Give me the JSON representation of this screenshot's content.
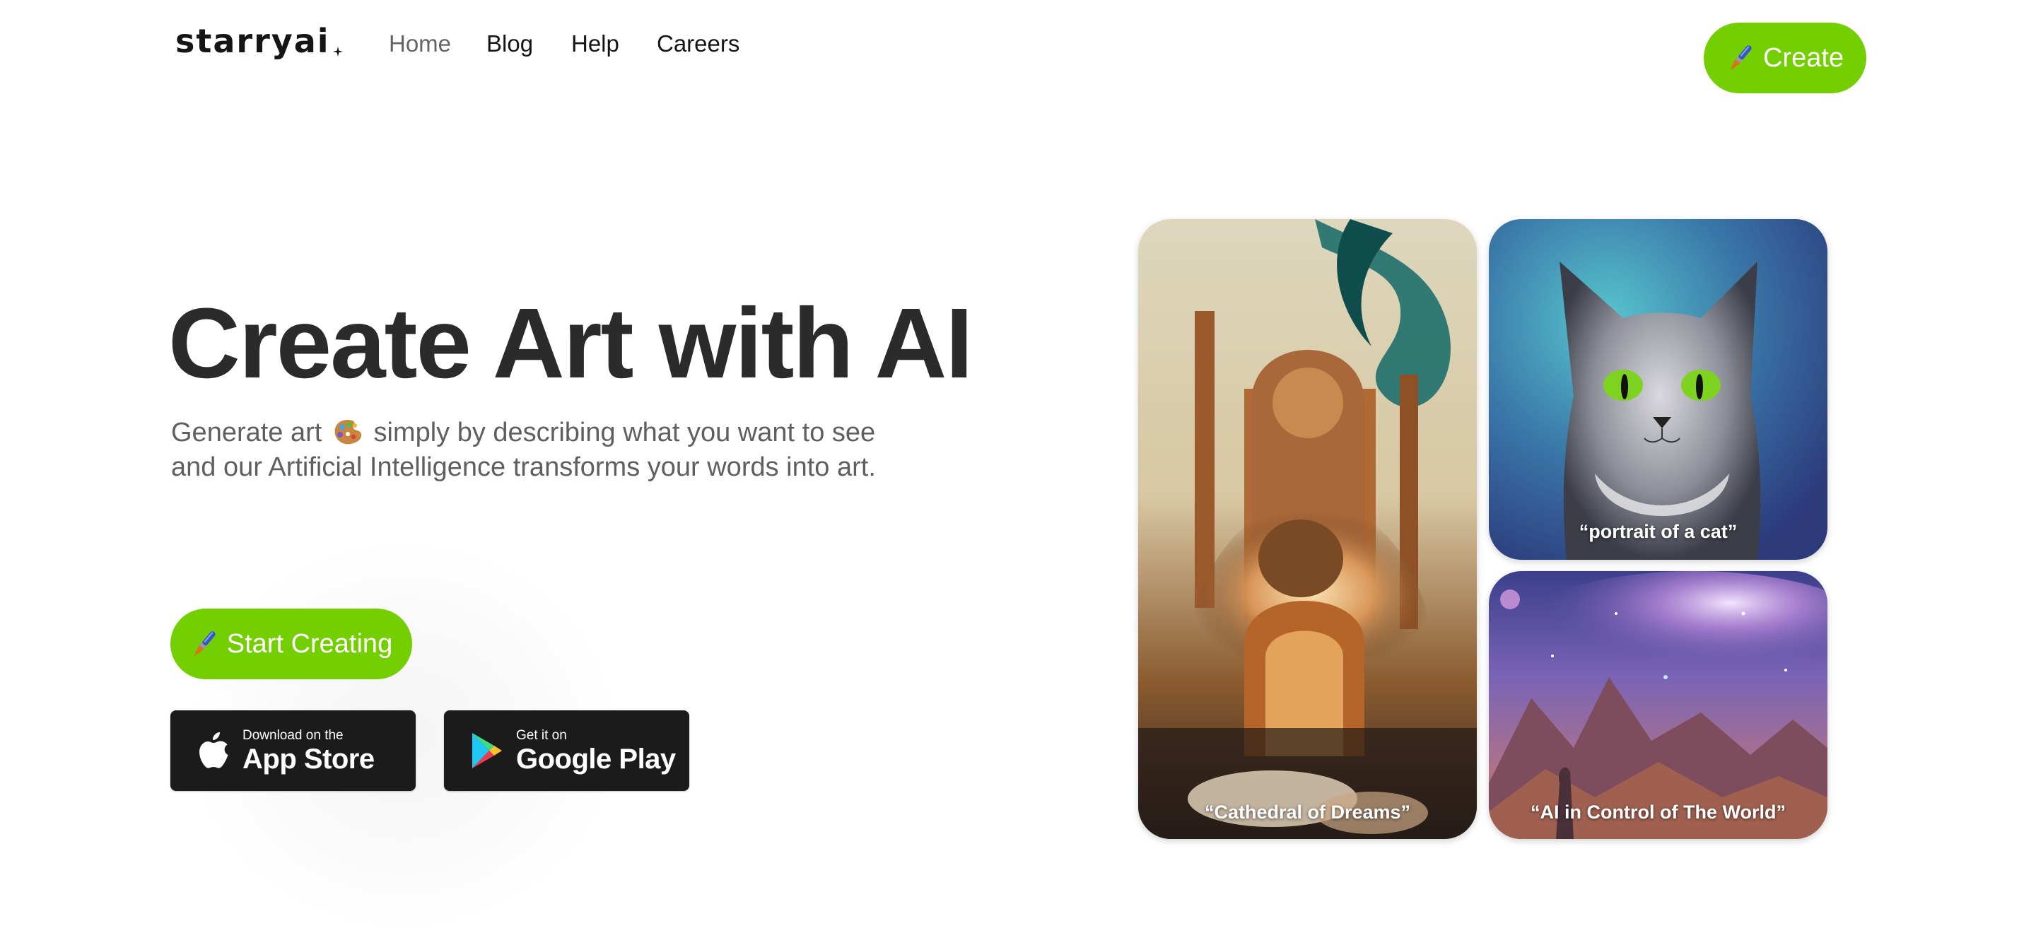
{
  "header": {
    "logo_text": "starryai",
    "logo_icon": "sparkle-icon",
    "nav": [
      {
        "label": "Home",
        "active": true
      },
      {
        "label": "Blog",
        "active": false
      },
      {
        "label": "Help",
        "active": false
      },
      {
        "label": "Careers",
        "active": false
      }
    ],
    "create_button": {
      "label": "Create",
      "icon": "paintbrush-icon"
    }
  },
  "hero": {
    "title": "Create Art with AI",
    "subtitle_line1_before": "Generate art",
    "subtitle_icon": "artist-palette-icon",
    "subtitle_line1_after": "simply by describing what you want to see",
    "subtitle_line2": "and our Artificial Intelligence transforms your words into art.",
    "start_button": {
      "label": "Start Creating",
      "icon": "paintbrush-icon"
    },
    "app_store": {
      "small": "Download on the",
      "big": "App Store",
      "icon": "apple-icon"
    },
    "google_play": {
      "small": "Get it on",
      "big": "Google Play",
      "icon": "google-play-icon"
    }
  },
  "gallery": [
    {
      "caption": "“Cathedral of Dreams”",
      "subject": "ornate fantasy cathedral"
    },
    {
      "caption": "“portrait of a cat”",
      "subject": "gray tabby cat with green eyes"
    },
    {
      "caption": "“AI in Control of The World”",
      "subject": "cosmic nebula over mountains with figure"
    }
  ],
  "colors": {
    "accent_green": "#73cf00",
    "heading": "#2b2b2b",
    "subtitle": "#5f5f5f",
    "nav_active": "#646464",
    "badge_bg": "#1b1b1b"
  }
}
